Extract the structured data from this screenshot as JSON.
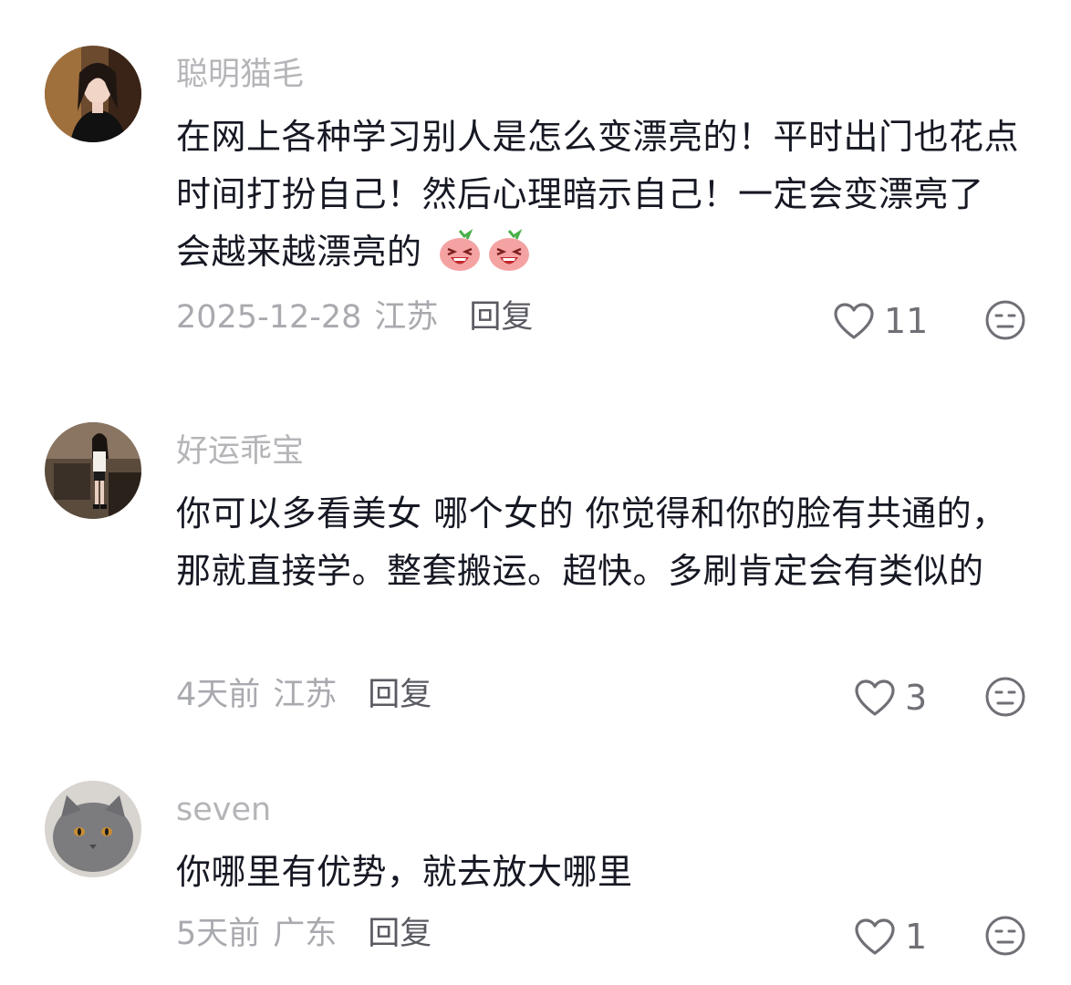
{
  "comments": [
    {
      "username": "聪明猫毛",
      "text": "在网上各种学习别人是怎么变漂亮的！平时出门也花点时间打扮自己！然后心理暗示自己！一定会变漂亮了 会越来越漂亮的",
      "date": "2025-12-28",
      "location": "江苏",
      "reply_label": "回复",
      "likes": "11",
      "avatar_icon": "woman-portrait-avatar",
      "emojis": [
        "laughing-peach-emoji",
        "laughing-peach-emoji"
      ]
    },
    {
      "username": "好运乖宝",
      "text": "你可以多看美女 哪个女的 你觉得和你的脸有共通的，那就直接学。整套搬运。超快。多刷肯定会有类似的",
      "date": "4天前",
      "location": "江苏",
      "reply_label": "回复",
      "likes": "3",
      "avatar_icon": "woman-standing-avatar"
    },
    {
      "username": "seven",
      "text": "你哪里有优势，就去放大哪里",
      "date": "5天前",
      "location": "广东",
      "reply_label": "回复",
      "likes": "1",
      "avatar_icon": "grey-cat-avatar"
    }
  ],
  "icons": {
    "like": "heart-outline-icon",
    "dislike": "neutral-face-icon"
  },
  "colors": {
    "text_primary": "#161823",
    "text_secondary": "#a9aaaf",
    "username": "#b5b5b9",
    "reply": "#5a5b62"
  }
}
